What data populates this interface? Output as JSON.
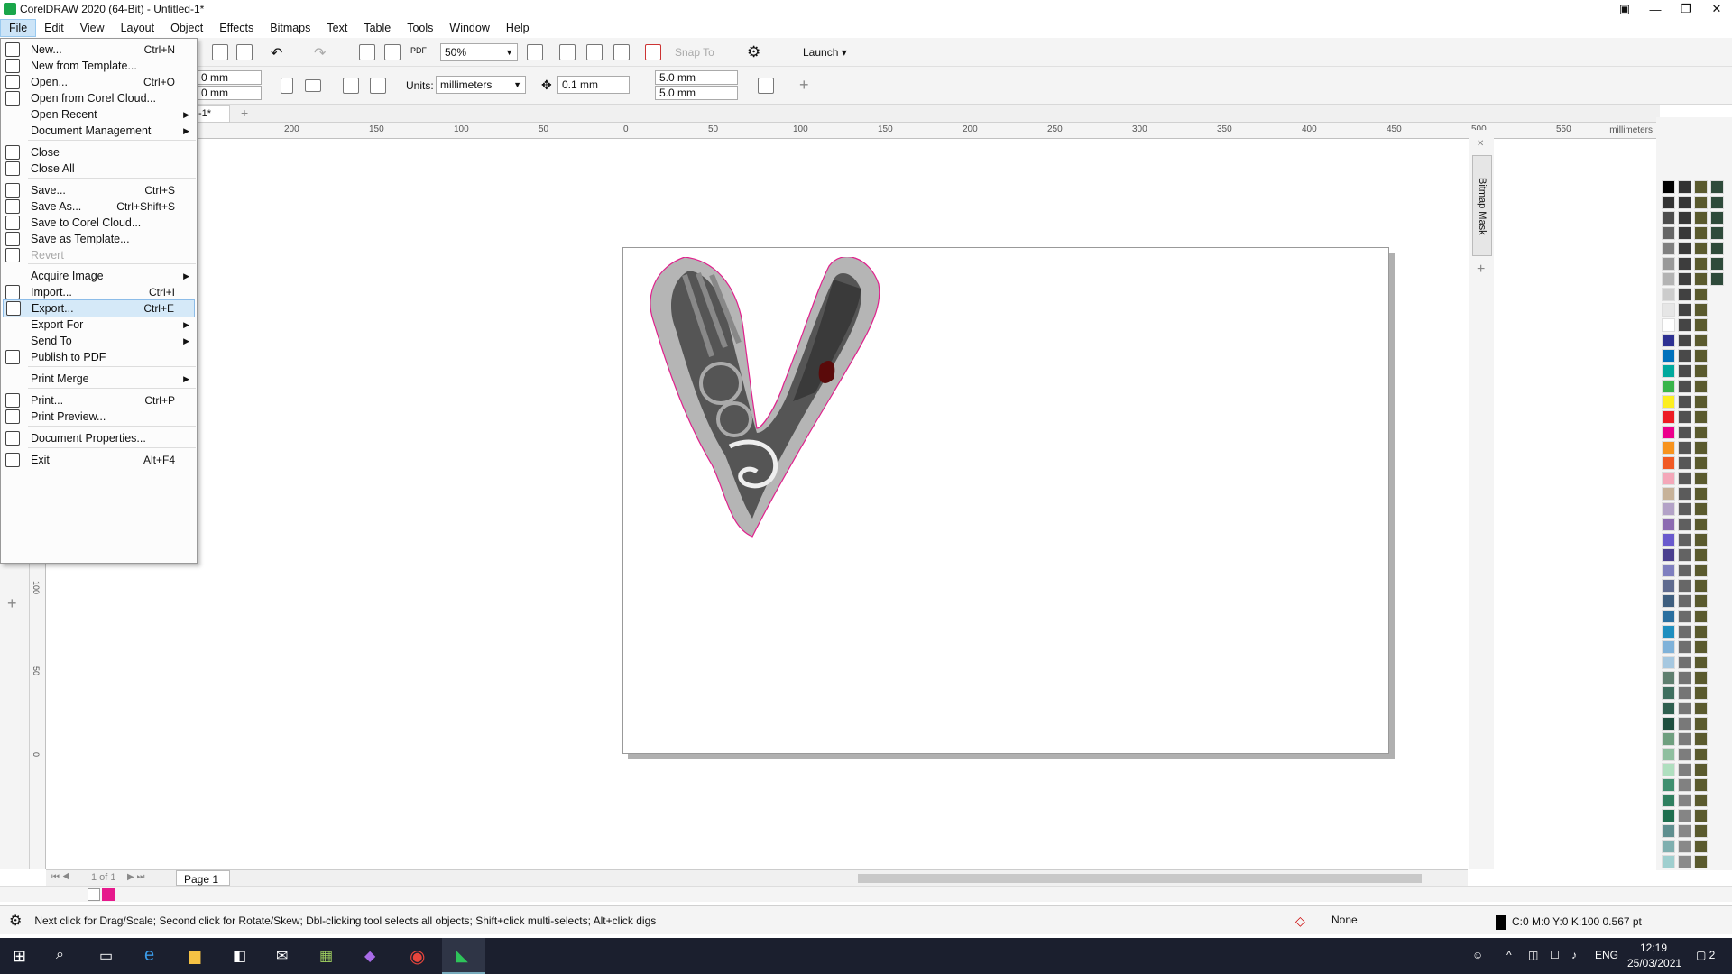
{
  "window": {
    "title": "CorelDRAW 2020 (64-Bit) - Untitled-1*"
  },
  "menubar": [
    "File",
    "Edit",
    "View",
    "Layout",
    "Object",
    "Effects",
    "Bitmaps",
    "Text",
    "Table",
    "Tools",
    "Window",
    "Help"
  ],
  "toolbar": {
    "zoom": "50%",
    "snap_to": "Snap To",
    "launch": "Launch"
  },
  "propbar": {
    "width": "0 mm",
    "height": "0 mm",
    "units_label": "Units:",
    "units": "millimeters",
    "nudge": "0.1 mm",
    "dup_x": "5.0 mm",
    "dup_y": "5.0 mm"
  },
  "doc_tab": "-1*",
  "ruler": {
    "unit": "millimeters",
    "top_ticks": [
      "200",
      "150",
      "100",
      "50",
      "0",
      "50",
      "100",
      "150",
      "200",
      "250",
      "300",
      "350",
      "400",
      "450",
      "500",
      "550"
    ],
    "left_ticks": [
      "100",
      "50",
      "0"
    ]
  },
  "file_menu": [
    {
      "label": "New...",
      "shortcut": "Ctrl+N",
      "icon": "new-doc-icon"
    },
    {
      "label": "New from Template...",
      "shortcut": "",
      "icon": "template-icon"
    },
    {
      "label": "Open...",
      "shortcut": "Ctrl+O",
      "icon": "open-folder-icon"
    },
    {
      "label": "Open from Corel Cloud...",
      "shortcut": "",
      "icon": "cloud-icon"
    },
    {
      "label": "Open Recent",
      "shortcut": "",
      "submenu": true
    },
    {
      "label": "Document Management",
      "shortcut": "",
      "submenu": true
    },
    {
      "label": "Close",
      "shortcut": "",
      "icon": "close-doc-icon"
    },
    {
      "label": "Close All",
      "shortcut": "",
      "icon": "close-all-icon"
    },
    {
      "label": "Save...",
      "shortcut": "Ctrl+S",
      "icon": "save-icon"
    },
    {
      "label": "Save As...",
      "shortcut": "Ctrl+Shift+S",
      "icon": "save-as-icon"
    },
    {
      "label": "Save to Corel Cloud...",
      "shortcut": "",
      "icon": "cloud-save-icon"
    },
    {
      "label": "Save as Template...",
      "shortcut": "",
      "icon": "save-template-icon"
    },
    {
      "label": "Revert",
      "shortcut": "",
      "icon": "revert-icon",
      "disabled": true
    },
    {
      "label": "Acquire Image",
      "shortcut": "",
      "submenu": true
    },
    {
      "label": "Import...",
      "shortcut": "Ctrl+I",
      "icon": "import-icon"
    },
    {
      "label": "Export...",
      "shortcut": "Ctrl+E",
      "icon": "export-icon",
      "highlighted": true
    },
    {
      "label": "Export For",
      "shortcut": "",
      "submenu": true
    },
    {
      "label": "Send To",
      "shortcut": "",
      "submenu": true
    },
    {
      "label": "Publish to PDF",
      "shortcut": "",
      "icon": "pdf-icon"
    },
    {
      "label": "Print Merge",
      "shortcut": "",
      "submenu": true
    },
    {
      "label": "Print...",
      "shortcut": "Ctrl+P",
      "icon": "print-icon"
    },
    {
      "label": "Print Preview...",
      "shortcut": "",
      "icon": "print-preview-icon"
    },
    {
      "label": "Document Properties...",
      "shortcut": "",
      "icon": "properties-icon"
    },
    {
      "label": "Exit",
      "shortcut": "Alt+F4",
      "icon": "power-icon"
    }
  ],
  "docker": {
    "label": "Bitmap Mask"
  },
  "pagebar": {
    "page_counter": "1 of 1",
    "page_tab": "Page 1"
  },
  "status": {
    "hint": "Next click for Drag/Scale; Second click for Rotate/Skew; Dbl-clicking tool selects all objects; Shift+click multi-selects; Alt+click digs",
    "fill": "None",
    "outline": "C:0 M:0 Y:0 K:100  0.567 pt"
  },
  "taskbar": {
    "lang": "ENG",
    "time": "12:19",
    "date": "25/03/2021",
    "notifications": "2"
  },
  "palette_colors": [
    "#000000",
    "#333333",
    "#4d4d4d",
    "#666666",
    "#808080",
    "#999999",
    "#b3b3b3",
    "#cccccc",
    "#e6e6e6",
    "#ffffff",
    "#2e3192",
    "#0071bc",
    "#00a99d",
    "#39b54a",
    "#fcee21",
    "#ed1c24",
    "#ec008c",
    "#f7931e",
    "#f15a24",
    "#f4a7b9",
    "#c7b299",
    "#b3a2c7",
    "#8c6bb1",
    "#6a5acd",
    "#4b3f8f",
    "#7f7fbf",
    "#5f6b8f",
    "#3f5f7f",
    "#2a6f9f",
    "#1f8fbf",
    "#7fb2d9",
    "#a6c8e0",
    "#5f7f6f",
    "#3f6f5f",
    "#2f5f4f",
    "#1f4f3f",
    "#6f9f7f",
    "#8fbf9f",
    "#afdfbf",
    "#3f8f6f",
    "#2f7f5f",
    "#1f6f4f",
    "#5f8f8f",
    "#7fafaf",
    "#9fcfcf"
  ]
}
